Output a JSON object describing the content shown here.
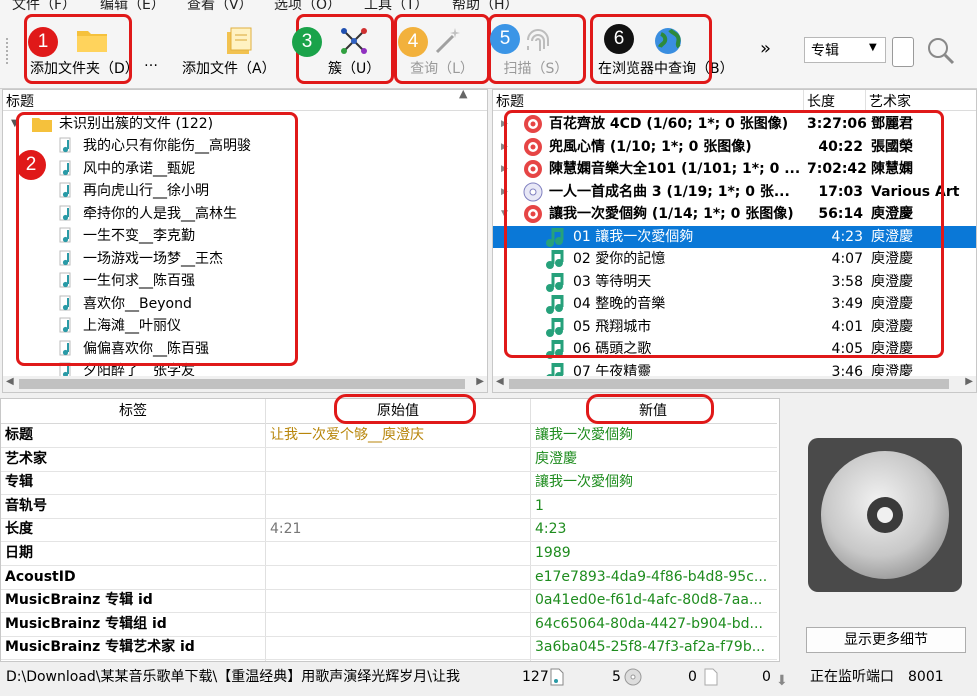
{
  "menu": [
    "文件（F）",
    "编辑（E）",
    "查看（V）",
    "选项（O）",
    "工具（T）",
    "帮助（H）"
  ],
  "toolbar": {
    "add_folder": "添加文件夹（D）",
    "add_files": "添加文件（A）",
    "cluster": "簇（U）",
    "lookup": "查询（L）",
    "scan": "扫描（S）",
    "browser_lookup": "在浏览器中查询（B）",
    "overflow": "»",
    "ellipsis": "…",
    "mode_select": "专辑",
    "colors": {
      "annotation": "#e01919"
    }
  },
  "annotations": [
    {
      "num": "1",
      "color": "#e01919"
    },
    {
      "num": "2",
      "color": "#e01919"
    },
    {
      "num": "3",
      "color": "#1aa34a"
    },
    {
      "num": "4",
      "color": "#f2b13c"
    },
    {
      "num": "5",
      "color": "#3b95e6"
    },
    {
      "num": "6",
      "color": "#111111"
    }
  ],
  "left_pane": {
    "header": "标题",
    "folder": "未识别出簇的文件 (122)",
    "files": [
      "我的心只有你能伤__高明骏",
      "风中的承诺__甄妮",
      "再向虎山行__徐小明",
      "牵持你的人是我__高林生",
      "一生不变__李克勤",
      "一场游戏一场梦__王杰",
      "一生何求__陈百强",
      "喜欢你__Beyond",
      "上海滩__叶丽仪",
      "偏偏喜欢你__陈百强",
      "夕阳醉了__张学友"
    ]
  },
  "right_pane": {
    "headers": {
      "title": "标题",
      "length": "长度",
      "artist": "艺术家"
    },
    "albums": [
      {
        "title": "百花齊放 4CD (1/60; 1*; 0 张图像)",
        "length": "3:27:06",
        "artist": "鄧麗君",
        "icon": "cd-red"
      },
      {
        "title": "兜風心情 (1/10; 1*; 0 张图像)",
        "length": "40:22",
        "artist": "張國榮",
        "icon": "cd-red"
      },
      {
        "title": "陳慧嫻音樂大全101 (1/101; 1*; 0 ...",
        "length": "7:02:42",
        "artist": "陳慧嫻",
        "icon": "cd-red"
      },
      {
        "title": "一人一首成名曲 3 (1/19; 1*; 0 张...",
        "length": "17:03",
        "artist": "Various Art",
        "icon": "cd-blue"
      },
      {
        "title": "讓我一次愛個夠 (1/14; 1*; 0 张图像)",
        "length": "56:14",
        "artist": "庾澄慶",
        "icon": "cd-red"
      }
    ],
    "tracks": [
      {
        "title": "01  讓我一次愛個夠",
        "length": "4:23",
        "artist": "庾澄慶",
        "selected": true
      },
      {
        "title": "02  愛你的記憶",
        "length": "4:07",
        "artist": "庾澄慶"
      },
      {
        "title": "03  等待明天",
        "length": "3:58",
        "artist": "庾澄慶"
      },
      {
        "title": "04  整晚的音樂",
        "length": "3:49",
        "artist": "庾澄慶"
      },
      {
        "title": "05  飛翔城市",
        "length": "4:01",
        "artist": "庾澄慶"
      },
      {
        "title": "06  碼頭之歌",
        "length": "4:05",
        "artist": "庾澄慶"
      },
      {
        "title": "07  午夜精靈",
        "length": "3:46",
        "artist": "庾澄慶"
      }
    ]
  },
  "metadata": {
    "headers": {
      "tag": "标签",
      "original": "原始值",
      "new": "新值"
    },
    "rows": [
      {
        "tag": "标题",
        "original": "让我一次爱个够__庾澄庆",
        "new": "讓我一次愛個夠"
      },
      {
        "tag": "艺术家",
        "original": "",
        "new": "庾澄慶"
      },
      {
        "tag": "专辑",
        "original": "",
        "new": "讓我一次愛個夠"
      },
      {
        "tag": "音轨号",
        "original": "",
        "new": "1"
      },
      {
        "tag": "长度",
        "original": "4:21",
        "new": "4:23"
      },
      {
        "tag": "日期",
        "original": "",
        "new": "1989"
      },
      {
        "tag": "AcoustID",
        "original": "",
        "new": "e17e7893-4da9-4f86-b4d8-95c..."
      },
      {
        "tag": "MusicBrainz 专辑 id",
        "original": "",
        "new": "0a41ed0e-f61d-4afc-80d8-7aa..."
      },
      {
        "tag": "MusicBrainz 专辑组 id",
        "original": "",
        "new": "64c65064-80da-4427-b904-bd..."
      },
      {
        "tag": "MusicBrainz 专辑艺术家 id",
        "original": "",
        "new": "3a6ba045-25f8-47f3-af2a-f79b..."
      }
    ]
  },
  "cover": {
    "more_details": "显示更多细节"
  },
  "status": {
    "path": "D:\\Download\\某某音乐歌单下载\\【重温经典】用歌声演绎光辉岁月\\让我",
    "files_count": "127",
    "albums_count": "5",
    "count3": "0",
    "count4": "0",
    "listening": "正在监听端口",
    "port": "8001"
  }
}
